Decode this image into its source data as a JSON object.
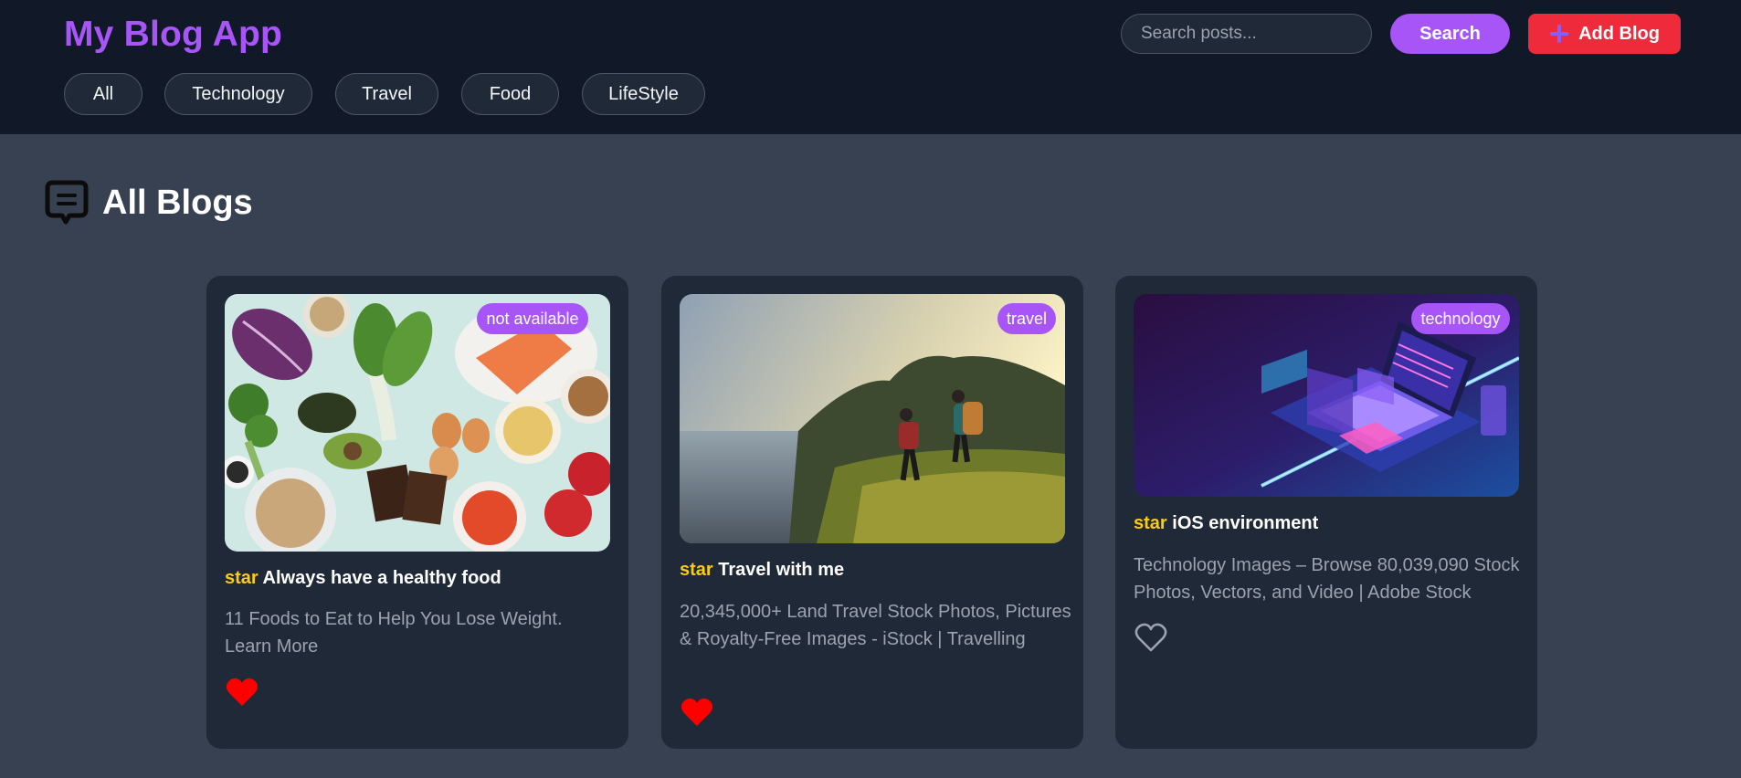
{
  "header": {
    "brand": "My Blog App",
    "search_placeholder": "Search posts...",
    "search_button": "Search",
    "add_blog_button": "Add Blog",
    "categories": [
      "All",
      "Technology",
      "Travel",
      "Food",
      "LifeStyle"
    ]
  },
  "section": {
    "title": "All Blogs",
    "icon": "chat-message-icon"
  },
  "colors": {
    "accent": "#a855f7",
    "add_button": "#ef2a3a",
    "star": "#facc15",
    "liked_heart": "#ff0000"
  },
  "posts": [
    {
      "badge": "not available",
      "star_label": "star",
      "title": "Always have a healthy food",
      "description": "11 Foods to Eat to Help You Lose Weight. Learn More",
      "liked": true,
      "image": "healthy-food-photo"
    },
    {
      "badge": "travel",
      "star_label": "star",
      "title": "Travel with me",
      "description": "20,345,000+ Land Travel Stock Photos, Pictures & Royalty-Free Images - iStock | Travelling",
      "liked": true,
      "image": "hikers-coast-photo"
    },
    {
      "badge": "technology",
      "star_label": "star",
      "title": "iOS environment",
      "description": "Technology Images – Browse 80,039,090 Stock Photos, Vectors, and Video | Adobe Stock",
      "liked": false,
      "image": "isometric-laptop-illustration"
    }
  ]
}
